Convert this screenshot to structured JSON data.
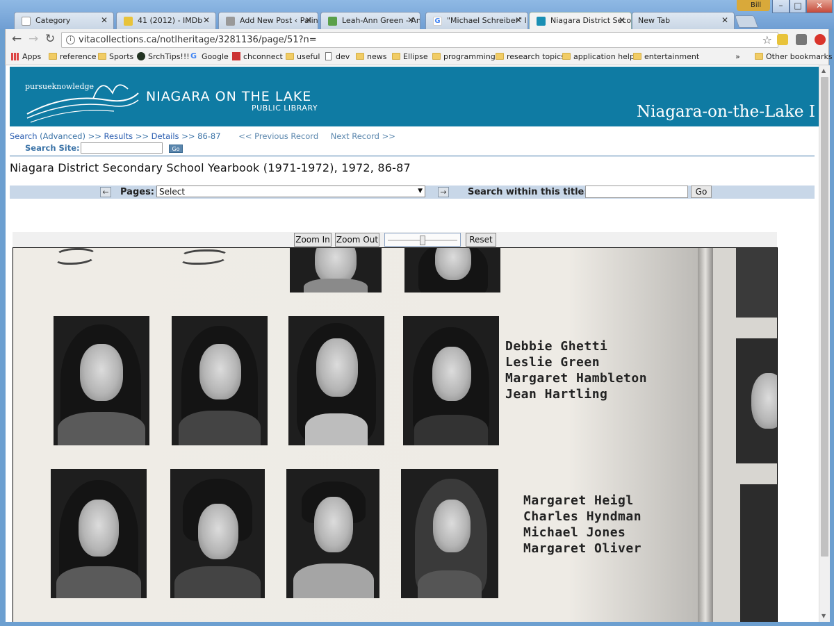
{
  "browser": {
    "user_name": "Bill",
    "window_controls": {
      "minimize": "–",
      "maximize": "□",
      "close": "✕"
    },
    "tabs": [
      {
        "label": "Category",
        "icon_color": "#ffffff",
        "active": false
      },
      {
        "label": "41 (2012) - IMDb",
        "icon_color": "#e8c33a",
        "active": false
      },
      {
        "label": "Add New Post ‹ Palin",
        "icon_color": "#666666",
        "active": false
      },
      {
        "label": "Leah-Ann Green - An",
        "icon_color": "#5aa04a",
        "active": false
      },
      {
        "label": "\"Michael Schreiber\" l",
        "icon_color": "#4285f4",
        "active": false
      },
      {
        "label": "Niagara District Seco",
        "icon_color": "#1a8fb4",
        "active": true
      },
      {
        "label": "New Tab",
        "icon_color": "",
        "active": false
      }
    ],
    "nav": {
      "back": "←",
      "forward": "→",
      "reload": "↻"
    },
    "address": "vitacollections.ca/notlheritage/3281136/page/51?n=",
    "star": "☆",
    "bookmarks": [
      {
        "label": "Apps",
        "icon": "apps-icon"
      },
      {
        "label": "reference",
        "icon": "folder-icon"
      },
      {
        "label": "Sports",
        "icon": "folder-icon"
      },
      {
        "label": "SrchTips!!!",
        "icon": "site-icon"
      },
      {
        "label": "Google",
        "icon": "google-icon"
      },
      {
        "label": "chconnect",
        "icon": "site-icon"
      },
      {
        "label": "useful",
        "icon": "folder-icon"
      },
      {
        "label": "dev",
        "icon": "page-icon"
      },
      {
        "label": "news",
        "icon": "folder-icon"
      },
      {
        "label": "Ellipse",
        "icon": "folder-icon"
      },
      {
        "label": "programming",
        "icon": "folder-icon"
      },
      {
        "label": "research topics",
        "icon": "folder-icon"
      },
      {
        "label": "application help",
        "icon": "folder-icon"
      },
      {
        "label": "entertainment",
        "icon": "folder-icon"
      }
    ],
    "bookmarks_overflow": "»",
    "other_bookmarks": "Other bookmarks"
  },
  "site": {
    "brand_accent": "#0f7ba3",
    "logo_text": "pursueknowledge",
    "library_name": "NIAGARA ON THE LAKE",
    "library_sub": "PUBLIC LIBRARY",
    "banner_right": "Niagara-on-the-Lake I",
    "breadcrumbs": {
      "search": "Search",
      "advanced": "(Advanced)",
      "sep1": ">>",
      "results": "Results",
      "sep2": ">>",
      "details": "Details",
      "sep3": ">>",
      "pages": "86-87",
      "prev": "<< Previous Record",
      "next": "Next Record >>"
    },
    "search_site_label": "Search Site:",
    "search_site_go": "Go",
    "record_title": "Niagara District Secondary School Yearbook (1971-1972), 1972, 86-87",
    "pages_label": "Pages:",
    "pages_select_value": "Select",
    "prev_arrow": "←",
    "next_arrow": "→",
    "search_within_label": "Search within this title:",
    "search_within_go": "Go",
    "zoom_in": "Zoom In",
    "zoom_out": "Zoom Out",
    "zoom_level": 0.5,
    "reset": "Reset"
  },
  "yearbook": {
    "row1_names": [
      "Debbie Ghetti",
      "Leslie Green",
      "Margaret Hambleton",
      "Jean Hartling"
    ],
    "row2_names": [
      "Margaret Heigl",
      "Charles Hyndman",
      "Michael Jones",
      "Margaret Oliver"
    ]
  }
}
